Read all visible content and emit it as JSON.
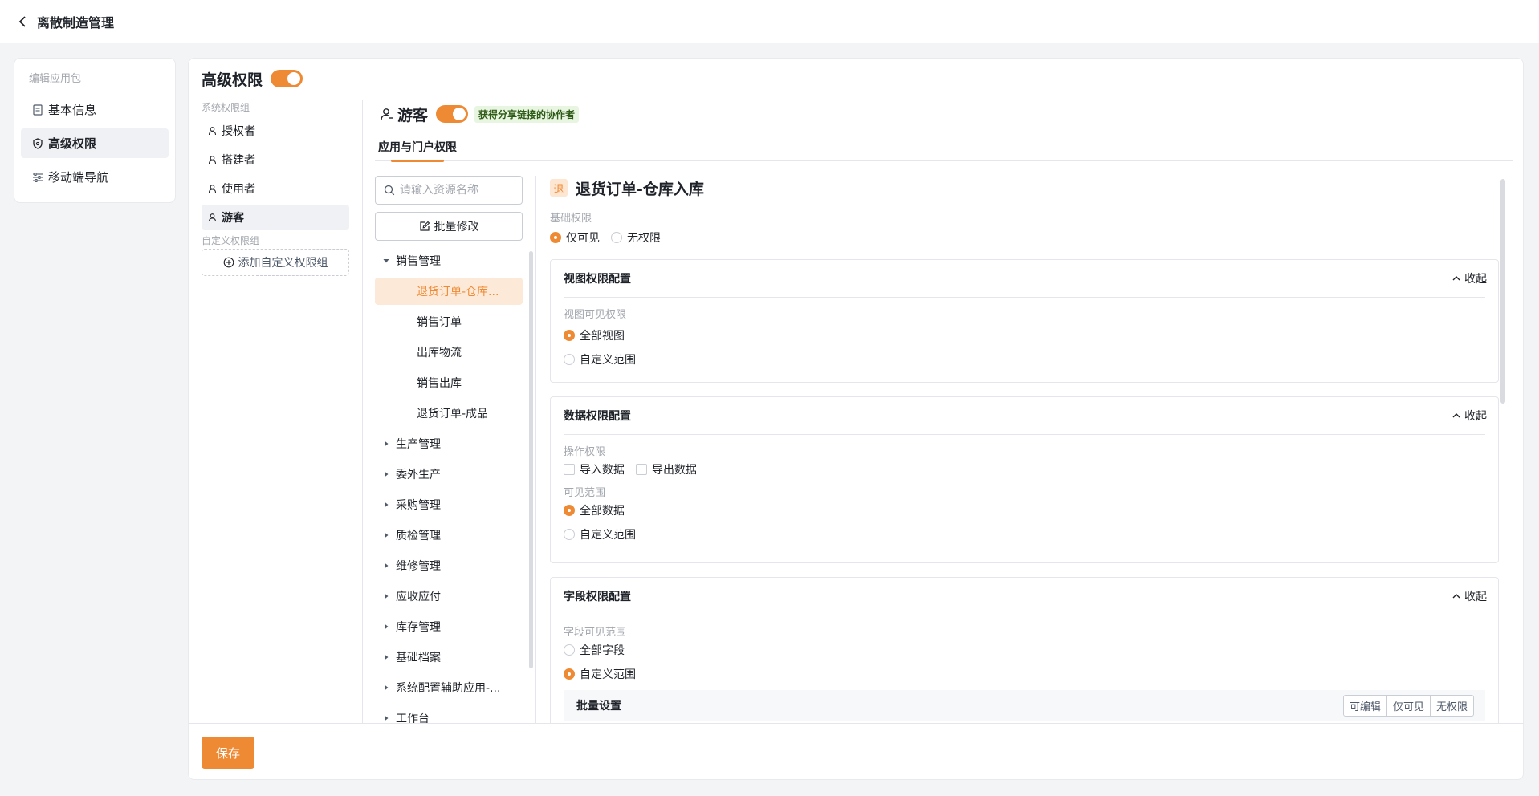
{
  "topbar": {
    "title": "离散制造管理",
    "back_icon": "chevron-left-icon"
  },
  "leftnav": {
    "caption": "编辑应用包",
    "items": [
      {
        "label": "基本信息",
        "icon": "document-icon"
      },
      {
        "label": "高级权限",
        "icon": "shield-icon"
      },
      {
        "label": "移动端导航",
        "icon": "sliders-icon"
      }
    ]
  },
  "main": {
    "title": "高级权限",
    "roles": {
      "system_caption": "系统权限组",
      "items": [
        {
          "label": "授权者"
        },
        {
          "label": "搭建者"
        },
        {
          "label": "使用者"
        },
        {
          "label": "游客"
        }
      ],
      "custom_caption": "自定义权限组",
      "add_label": "添加自定义权限组"
    },
    "role_header": {
      "name": "游客",
      "badge": "获得分享链接的协作者"
    },
    "tab": "应用与门户权限",
    "tree": {
      "search_placeholder": "请输入资源名称",
      "batch_label": "批量修改",
      "groups": [
        {
          "label": "销售管理"
        },
        {
          "label": "生产管理"
        },
        {
          "label": "委外生产"
        },
        {
          "label": "采购管理"
        },
        {
          "label": "质检管理"
        },
        {
          "label": "维修管理"
        },
        {
          "label": "应收应付"
        },
        {
          "label": "库存管理"
        },
        {
          "label": "基础档案"
        },
        {
          "label": "系统配置辅助应用-..."
        },
        {
          "label": "工作台"
        }
      ],
      "children": [
        {
          "label": "退货订单-仓库..."
        },
        {
          "label": "销售订单"
        },
        {
          "label": "出库物流"
        },
        {
          "label": "销售出库"
        },
        {
          "label": "退货订单-成品"
        }
      ]
    },
    "detail": {
      "tag": "退",
      "title": "退货订单-仓库入库",
      "basic_label": "基础权限",
      "basic_options": [
        "仅可见",
        "无权限"
      ],
      "collapse_label": "收起",
      "view": {
        "title": "视图权限配置",
        "sub_label": "视图可见权限",
        "options": [
          "全部视图",
          "自定义范围"
        ]
      },
      "data": {
        "title": "数据权限配置",
        "op_label": "操作权限",
        "op_options": [
          "导入数据",
          "导出数据"
        ],
        "scope_label": "可见范围",
        "scope_options": [
          "全部数据",
          "自定义范围"
        ]
      },
      "field": {
        "title": "字段权限配置",
        "sub_label": "字段可见范围",
        "options": [
          "全部字段",
          "自定义范围"
        ],
        "batch_label": "批量设置",
        "batch_options": [
          "可编辑",
          "仅可见",
          "无权限"
        ]
      }
    },
    "save_label": "保存"
  },
  "colors": {
    "accent": "#ef8a34",
    "badge_bg": "#e8f5e0"
  }
}
